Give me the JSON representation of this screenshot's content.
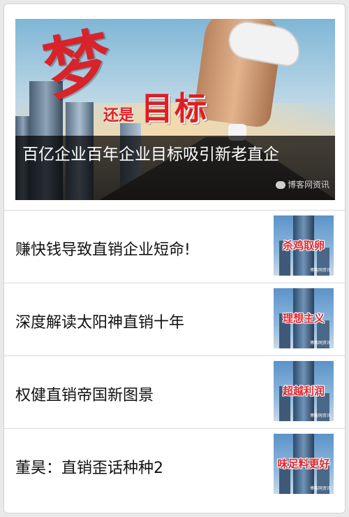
{
  "hero": {
    "image_text_large": "梦",
    "image_text_small": "还是",
    "image_text_target": "目标",
    "caption": "百亿企业百年企业目标吸引新老直企",
    "watermark": "博客网资讯"
  },
  "articles": [
    {
      "title": "赚快钱导致直销企业短命!",
      "thumb_label": "杀鸡取卵",
      "thumb_watermark": "博客网资讯"
    },
    {
      "title": "深度解读太阳神直销十年",
      "thumb_label": "理想主义",
      "thumb_watermark": "博客网资讯"
    },
    {
      "title": "权健直销帝国新图景",
      "thumb_label": "超越利润",
      "thumb_watermark": "博客网资讯"
    },
    {
      "title": "董昊：直销歪话种种2",
      "thumb_label": "味足料更好",
      "thumb_watermark": "博客网资讯"
    }
  ],
  "colors": {
    "accent_red": "#e1262d",
    "caption_bg": "#000000",
    "card_bg": "#ffffff"
  }
}
